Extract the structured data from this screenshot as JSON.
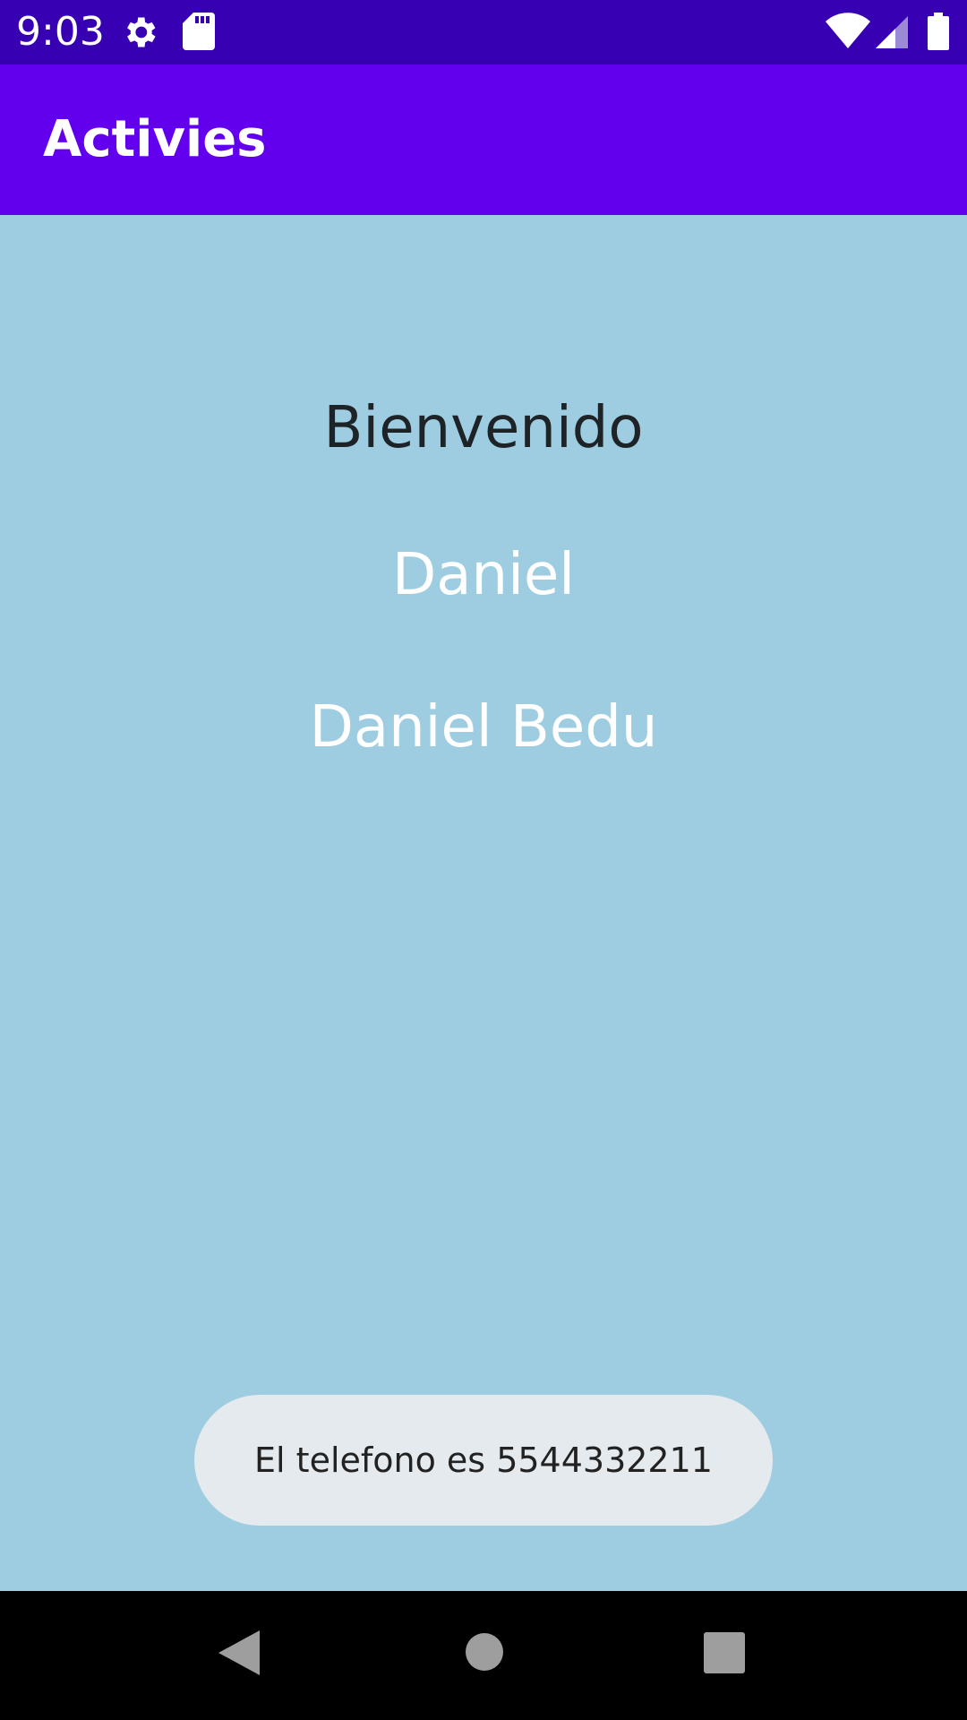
{
  "status_bar": {
    "time": "9:03",
    "icons": [
      "gear-icon",
      "sd-card-icon",
      "wifi-icon",
      "signal-icon",
      "battery-icon"
    ]
  },
  "app_bar": {
    "title": "Activies",
    "color": "#6200ee"
  },
  "main": {
    "greeting": "Bienvenido",
    "name": "Daniel",
    "full_name": "Daniel Bedu",
    "background": "#9ecde1"
  },
  "toast": {
    "message": "El telefono es 5544332211"
  },
  "nav_bar": {
    "buttons": [
      "back-icon",
      "home-icon",
      "recents-icon"
    ]
  }
}
